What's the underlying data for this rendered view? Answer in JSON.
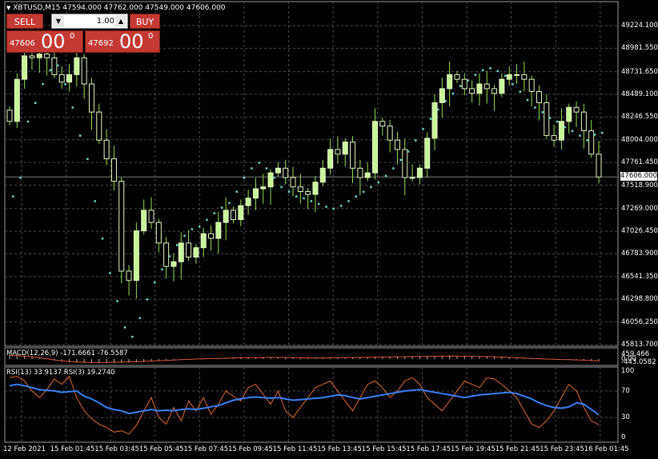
{
  "window": {
    "title": "XBTUSD,M15  47594.000 47762.000 47549.000 47606.000"
  },
  "trade_panel": {
    "sell_label": "SELL",
    "buy_label": "BUY",
    "lot_value": "1.00",
    "bid_small": "47606",
    "bid_big": "00",
    "bid_sup": "0",
    "ask_small": "47692",
    "ask_big": "00",
    "ask_sup": "0"
  },
  "current_price_tag": "47606.000",
  "indicators": {
    "macd_title": "MACD(12,26,9) -171.6661 -76.5587",
    "rsi_title": "RSI(13) 33.9137  RSI(3) 19.2740"
  },
  "colors": {
    "background": "#000000",
    "candle_bull": "#e6f7c2",
    "candle_bear_wick": "#90e050",
    "candle_bull_body": "#c8f59a",
    "grid": "#4a4a4a",
    "sar": "#6ad6d0",
    "rsi_slow": "#3a7ff5",
    "rsi_fast": "#e06a2e",
    "macd": "#d9553b"
  },
  "chart_data": [
    {
      "type": "candlestick",
      "title": "XBTUSD,M15",
      "ylim": [
        45813.7,
        49400
      ],
      "y_ticks": [
        "49224.100",
        "48981.550",
        "48731.650",
        "48489.100",
        "48246.550",
        "48004.000",
        "47761.450",
        "47518.900",
        "47269.000",
        "47026.450",
        "46783.900",
        "46541.350",
        "46298.800",
        "46056.250",
        "45813.700"
      ],
      "x_ticks": [
        "12 Feb 2021",
        "15 Feb 01:45",
        "15 Feb 03:45",
        "15 Feb 05:45",
        "15 Feb 07:45",
        "15 Feb 09:45",
        "15 Feb 11:45",
        "15 Feb 13:45",
        "15 Feb 15:45",
        "15 Feb 17:45",
        "15 Feb 19:45",
        "15 Feb 21:45",
        "15 Feb 23:45",
        "16 Feb 01:45"
      ],
      "close_series": [
        48200,
        48650,
        48900,
        48880,
        48920,
        48880,
        48700,
        48620,
        48700,
        48880,
        48600,
        48300,
        48000,
        47800,
        47560,
        46600,
        46500,
        47030,
        47250,
        47120,
        46900,
        46650,
        46700,
        46900,
        46750,
        46850,
        47000,
        46950,
        47120,
        47250,
        47150,
        47300,
        47380,
        47480,
        47500,
        47650,
        47700,
        47600,
        47500,
        47450,
        47420,
        47550,
        47700,
        47900,
        47850,
        47980,
        47700,
        47600,
        47650,
        48200,
        48150,
        48000,
        47900,
        47600,
        47600,
        47700,
        48020,
        48400,
        48550,
        48700,
        48650,
        48550,
        48500,
        48600,
        48550,
        48500,
        48650,
        48700,
        48700,
        48650,
        48520,
        48400,
        48050,
        48000,
        48200,
        48350,
        48300,
        48100,
        47850,
        47606
      ],
      "parabolic_sar": [
        47400,
        47600,
        48200,
        48400,
        48600,
        48750,
        48800,
        48600,
        48350,
        48050,
        47800,
        47350,
        46950,
        46580,
        46280,
        46000,
        45900,
        46100,
        46300,
        46480,
        46620,
        46760,
        46880,
        46980,
        47050,
        47080,
        47150,
        47220,
        47280,
        47330,
        47450,
        47600,
        47700,
        47760,
        47700,
        47600,
        47500,
        47450,
        47400,
        47380,
        47350,
        47320,
        47290,
        47270,
        47300,
        47350,
        47400,
        47450,
        47500,
        47550,
        47620,
        47700,
        47790,
        47880,
        48000,
        48120,
        48230,
        48330,
        48420,
        48500,
        48580,
        48640,
        48700,
        48750,
        48770,
        48740,
        48690,
        48600,
        48520,
        48430,
        48350,
        48300,
        48240,
        48200,
        48140,
        48100,
        48050,
        48000,
        48060,
        48080
      ]
    },
    {
      "type": "line",
      "title": "MACD(12,26,9) -171.6661 -76.5587",
      "y_ticks": [
        "459.466",
        "0.00",
        "-443.0582"
      ],
      "series": [
        {
          "values": [
            320,
            300,
            250,
            200,
            120,
            20,
            -80,
            -160,
            -220,
            -260,
            -290,
            -300,
            -310,
            -300,
            -290,
            -280,
            -260,
            -240,
            -210,
            -180,
            -150,
            -120,
            -90,
            -60,
            -30,
            0,
            20,
            40,
            60,
            80,
            100,
            110,
            120,
            130,
            140,
            150,
            150,
            140,
            130,
            120,
            110,
            100,
            100,
            110,
            120,
            130,
            140,
            150,
            160,
            170,
            180,
            190,
            200,
            210,
            220,
            230,
            240,
            250,
            260,
            270,
            260,
            250,
            240,
            230,
            220,
            200,
            180,
            150,
            120,
            90,
            60,
            30,
            0,
            -20,
            -40,
            -60,
            -80,
            -100,
            -140,
            -171
          ]
        }
      ]
    },
    {
      "type": "line",
      "title": "RSI(13) 33.9137  RSI(3) 19.2740",
      "ylim": [
        0,
        100
      ],
      "y_ticks": [
        "100",
        "70",
        "30",
        "0"
      ],
      "series": [
        {
          "name": "RSI(13)",
          "values": [
            78,
            80,
            78,
            75,
            72,
            71,
            70,
            68,
            69,
            70,
            62,
            58,
            52,
            45,
            42,
            40,
            36,
            38,
            40,
            42,
            40,
            41,
            40,
            42,
            43,
            42,
            44,
            46,
            48,
            52,
            56,
            58,
            60,
            61,
            60,
            59,
            60,
            58,
            56,
            57,
            58,
            59,
            60,
            62,
            64,
            63,
            60,
            58,
            60,
            62,
            64,
            66,
            68,
            70,
            71,
            72,
            70,
            68,
            66,
            64,
            62,
            60,
            62,
            64,
            65,
            66,
            67,
            68,
            66,
            62,
            58,
            52,
            48,
            45,
            44,
            46,
            52,
            50,
            42,
            34
          ]
        },
        {
          "name": "RSI(3)",
          "values": [
            90,
            92,
            85,
            70,
            60,
            72,
            88,
            80,
            92,
            60,
            40,
            28,
            20,
            15,
            8,
            10,
            5,
            18,
            40,
            60,
            30,
            20,
            45,
            25,
            55,
            40,
            60,
            35,
            50,
            70,
            62,
            55,
            75,
            80,
            65,
            50,
            70,
            40,
            30,
            45,
            60,
            75,
            80,
            85,
            70,
            55,
            40,
            60,
            80,
            85,
            75,
            60,
            70,
            85,
            90,
            80,
            60,
            50,
            40,
            55,
            70,
            85,
            80,
            75,
            90,
            88,
            80,
            70,
            60,
            40,
            20,
            15,
            25,
            40,
            60,
            80,
            70,
            45,
            25,
            19
          ]
        }
      ]
    }
  ]
}
